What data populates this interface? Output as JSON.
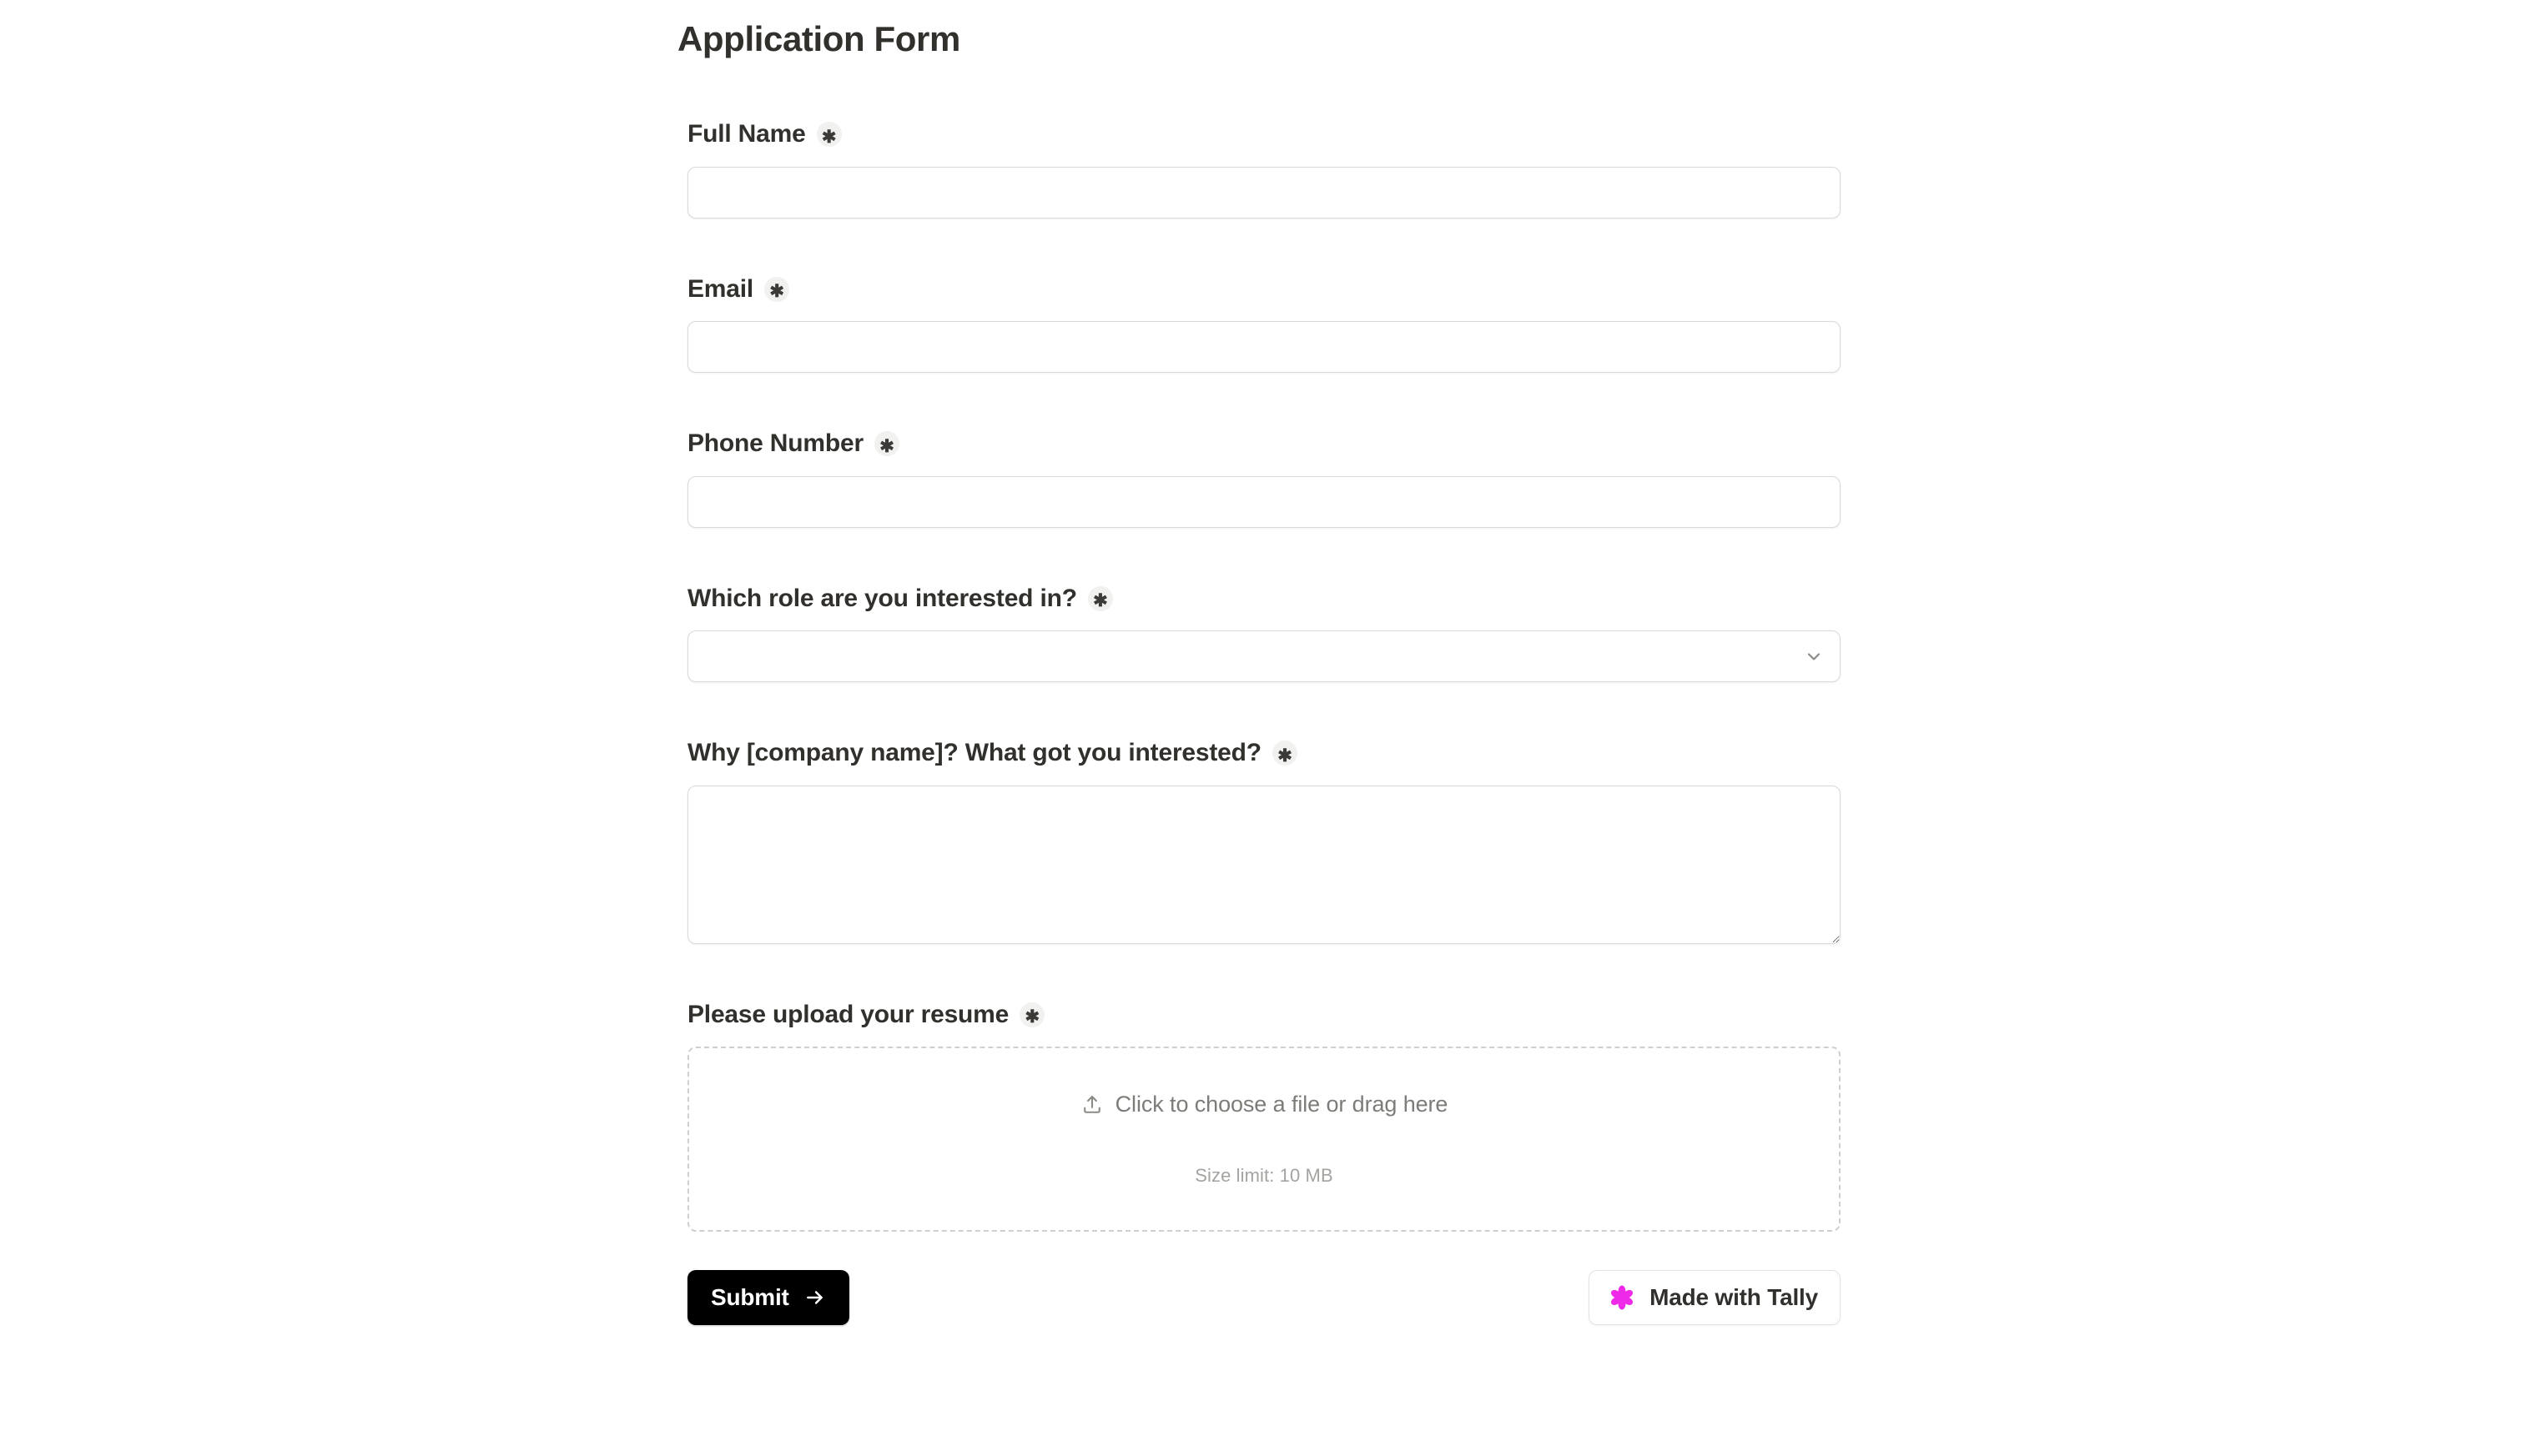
{
  "form": {
    "title": "Application Form",
    "required_marker": "✱",
    "fields": [
      {
        "id": "full-name",
        "label": "Full Name",
        "required": true,
        "type": "text",
        "value": "",
        "placeholder": ""
      },
      {
        "id": "email",
        "label": "Email",
        "required": true,
        "type": "text",
        "value": "",
        "placeholder": ""
      },
      {
        "id": "phone-number",
        "label": "Phone Number",
        "required": true,
        "type": "text",
        "value": "",
        "placeholder": ""
      },
      {
        "id": "role",
        "label": "Which role are you interested in?",
        "required": true,
        "type": "select",
        "value": "",
        "placeholder": "",
        "icon": "chevron-down-icon"
      },
      {
        "id": "why-company",
        "label": "Why [company name]? What got you interested?",
        "required": true,
        "type": "textarea",
        "value": "",
        "placeholder": ""
      },
      {
        "id": "resume-upload",
        "label": "Please upload your resume",
        "required": true,
        "type": "file",
        "dropzone_text": "Click to choose a file or drag here",
        "size_limit_text": "Size limit: 10 MB",
        "icon": "upload-icon"
      }
    ]
  },
  "footer": {
    "submit_label": "Submit",
    "submit_icon": "arrow-right-icon",
    "tally_label": "Made with Tally",
    "tally_icon": "tally-flower-icon"
  },
  "colors": {
    "text": "#32302c",
    "muted": "#7c7c78",
    "faint": "#a3a3a0",
    "border": "#d9d9d7",
    "dashed_border": "#cfcfcd",
    "badge_bg": "#f1f1f0",
    "submit_bg": "#000000",
    "submit_text": "#ffffff",
    "tally_pink": "#ee2ae8",
    "page_bg": "#ffffff"
  }
}
